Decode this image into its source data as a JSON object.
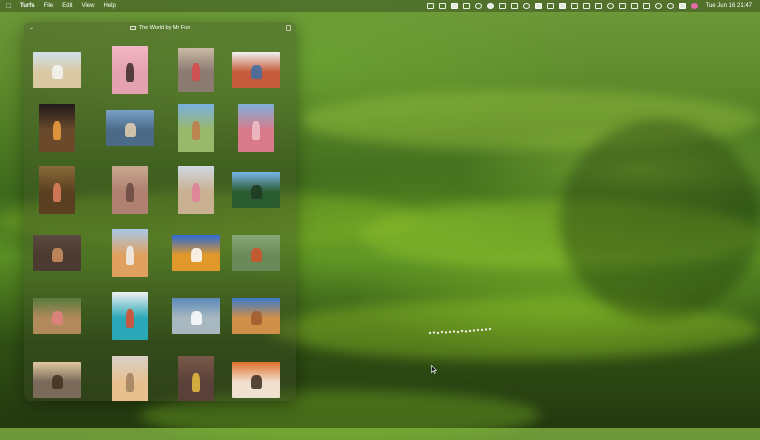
{
  "menubar": {
    "apple_icon": "apple-logo-icon",
    "app_name": "Turfs",
    "menus": [
      "File",
      "Edit",
      "View",
      "Help"
    ],
    "clock": "Tue Jun 16  21:47"
  },
  "window": {
    "title": "The World by Mr Fun",
    "close_icon": "close-icon",
    "folder_icon": "folder-icon"
  },
  "thumbnails": [
    {
      "name": "beach-boats",
      "sky": "#cfe0ea",
      "ground": "#d9c9a3",
      "accent": "#f4f4f4"
    },
    {
      "name": "pink-portrait",
      "sky": "#f1b6c5",
      "ground": "#e4a2b0",
      "accent": "#3a2a2a"
    },
    {
      "name": "car-street",
      "sky": "#c9b9a5",
      "ground": "#8a7a70",
      "accent": "#d84a4a"
    },
    {
      "name": "framed-window",
      "sky": "#f2f2f2",
      "ground": "#c55a3a",
      "accent": "#3c6ea8"
    },
    {
      "name": "temple-reflection",
      "sky": "#1f1a18",
      "ground": "#6a4a2a",
      "accent": "#f0a040"
    },
    {
      "name": "palace-lake",
      "sky": "#7aa0c8",
      "ground": "#4a6a88",
      "accent": "#e8d0b0"
    },
    {
      "name": "red-fort",
      "sky": "#79b0e0",
      "ground": "#9ab86a",
      "accent": "#c27a4a"
    },
    {
      "name": "pink-palace",
      "sky": "#7fb0d8",
      "ground": "#d87a8a",
      "accent": "#f0c0c8"
    },
    {
      "name": "tree-trunk",
      "sky": "#8a6a3a",
      "ground": "#5a4020",
      "accent": "#e08060"
    },
    {
      "name": "archway-corridor",
      "sky": "#c8a890",
      "ground": "#b08070",
      "accent": "#6a4a40"
    },
    {
      "name": "lady-in-pink",
      "sky": "#cfd8e0",
      "ground": "#c9b090",
      "accent": "#e0809a"
    },
    {
      "name": "palm-trees",
      "sky": "#7ab4e8",
      "ground": "#2a5a30",
      "accent": "#1e3a20"
    },
    {
      "name": "rustic-interior",
      "sky": "#5a4a40",
      "ground": "#4a3a30",
      "accent": "#d09060"
    },
    {
      "name": "dancer-desert",
      "sky": "#a8c8e8",
      "ground": "#e0a060",
      "accent": "#f0f0f0"
    },
    {
      "name": "desert-sky",
      "sky": "#2a6ad8",
      "ground": "#e0982a",
      "accent": "#ffffff"
    },
    {
      "name": "boat-lake",
      "sky": "#88a878",
      "ground": "#6a8a5a",
      "accent": "#d0502a"
    },
    {
      "name": "pond-garden",
      "sky": "#5a7a40",
      "ground": "#b08a5a",
      "accent": "#e08080"
    },
    {
      "name": "blue-door",
      "sky": "#f0f0f0",
      "ground": "#2aa8b8",
      "accent": "#e04a2a"
    },
    {
      "name": "aerial-coast",
      "sky": "#5a8ab8",
      "ground": "#a8b8c0",
      "accent": "#ffffff"
    },
    {
      "name": "desert-camp",
      "sky": "#3a7ac8",
      "ground": "#d0904a",
      "accent": "#a05a30"
    },
    {
      "name": "railway-sunset",
      "sky": "#e0c8a0",
      "ground": "#7a6a5a",
      "accent": "#403020"
    },
    {
      "name": "white-arch",
      "sky": "#d8d0c8",
      "ground": "#e8c090",
      "accent": "#a08060"
    },
    {
      "name": "yellow-dress",
      "sky": "#7a5a4a",
      "ground": "#5a4038",
      "accent": "#e8c040"
    },
    {
      "name": "orange-dunes",
      "sky": "#e0702a",
      "ground": "#f0e0d0",
      "accent": "#3a2a20"
    }
  ],
  "cursor_icon": "arrow-cursor-icon"
}
